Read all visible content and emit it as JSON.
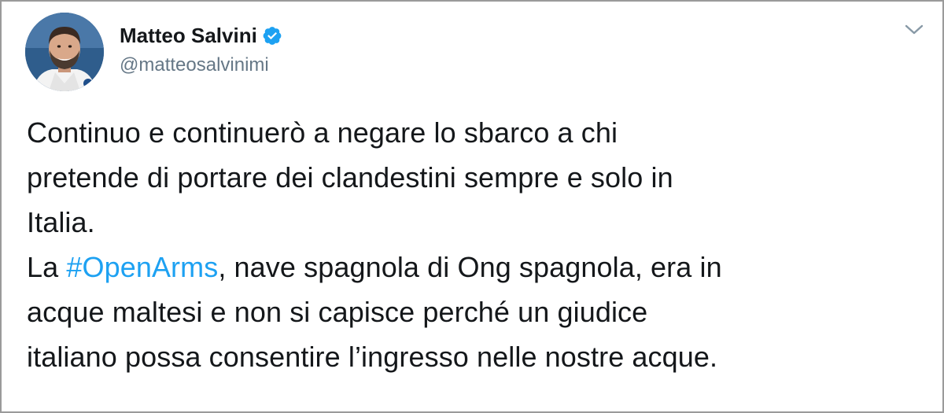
{
  "author": {
    "name": "Matteo Salvini",
    "handle": "@matteosalvinimi",
    "verified": true
  },
  "tweet": {
    "lines": [
      "Continuo e continuerò a negare lo sbarco a chi",
      "pretende di portare dei clandestini sempre e solo in",
      "Italia."
    ],
    "line4_prefix": "La ",
    "hashtag": "#OpenArms",
    "line4_suffix": ", nave spagnola di Ong spagnola, era in",
    "lines_after": [
      "acque maltesi e non si capisce perché un giudice",
      "italiano possa consentire l’ingresso nelle nostre acque."
    ]
  },
  "colors": {
    "hashtag": "#1da1f2",
    "verified_badge": "#1da1f2",
    "text": "#14171a",
    "secondary_text": "#657786"
  },
  "icons": {
    "verified": "verified-badge-icon",
    "menu": "chevron-down-icon"
  }
}
